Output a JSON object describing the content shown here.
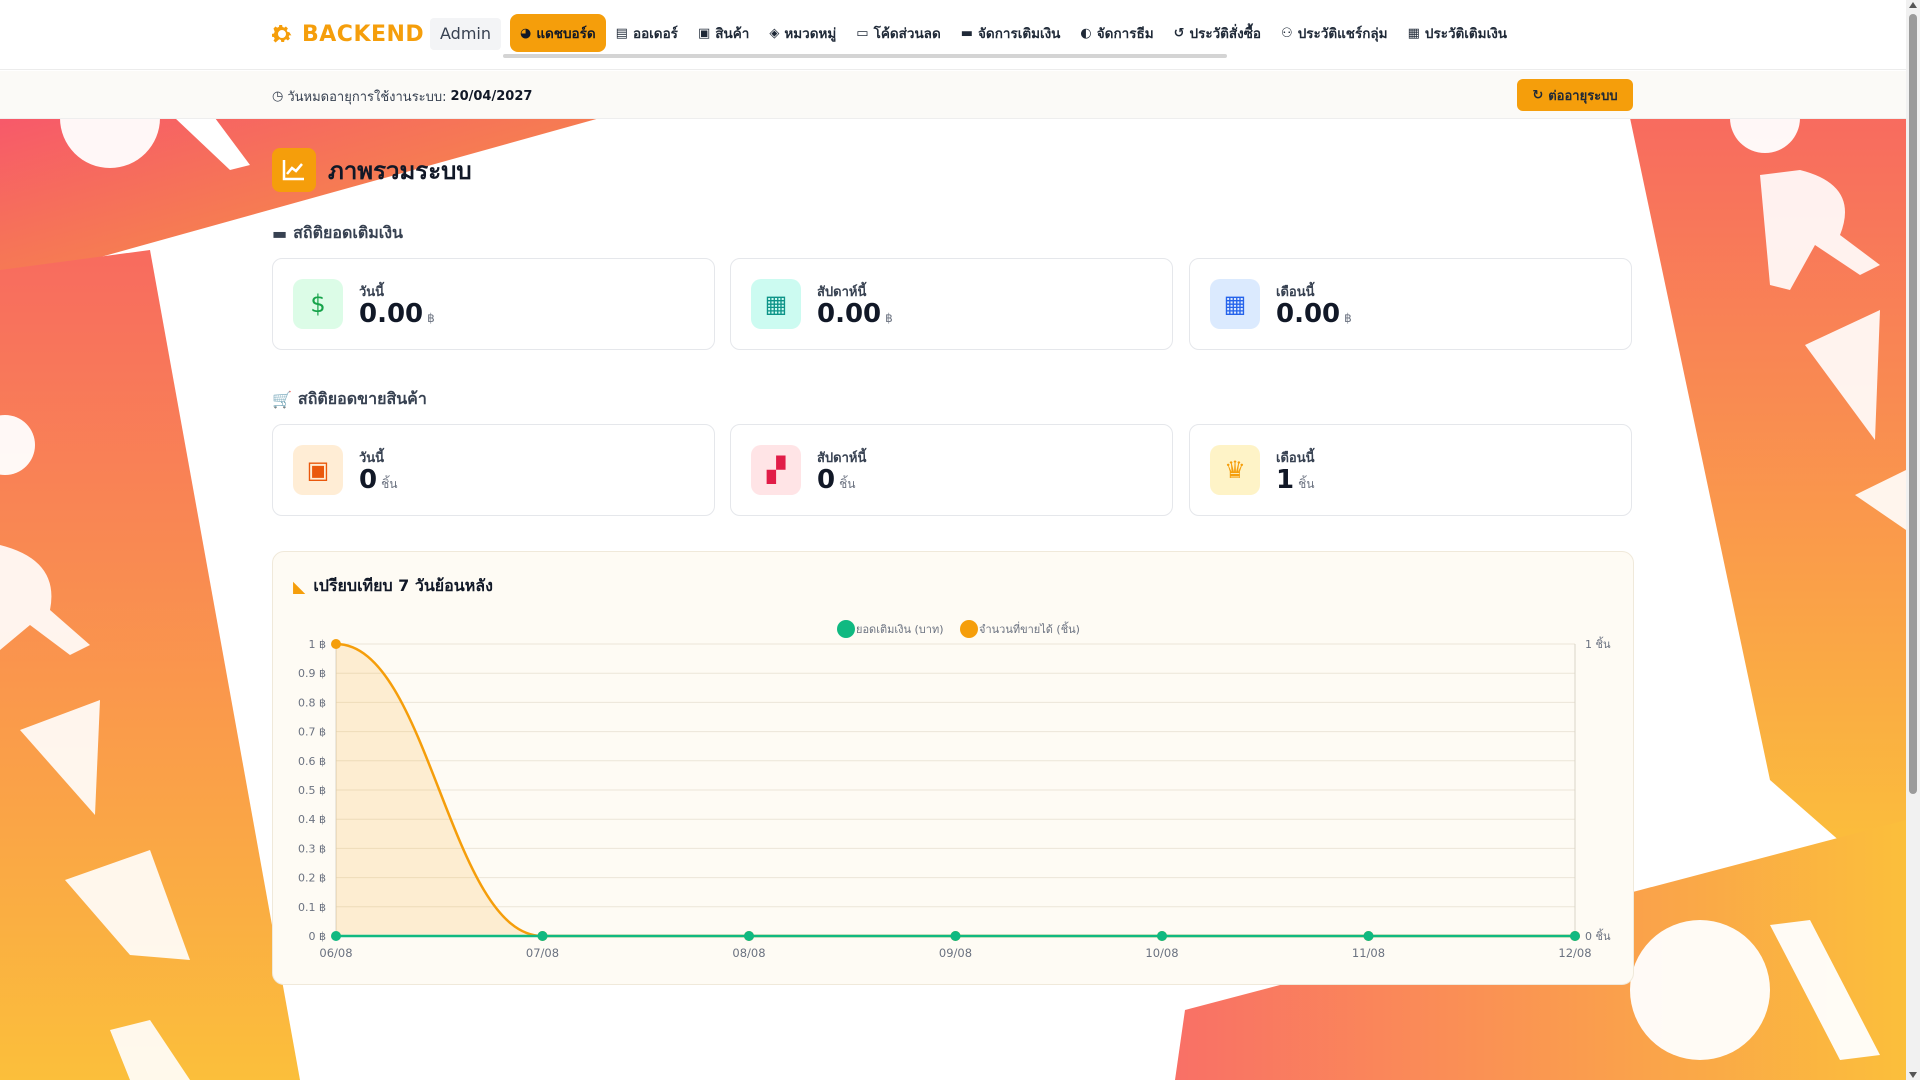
{
  "brand": {
    "name": "BACKEND",
    "role": "Admin",
    "icon": "gear-icon",
    "color": "#f59e0b"
  },
  "nav": {
    "items": [
      {
        "label": "แดชบอร์ด",
        "icon": "dashboard-icon",
        "active": true
      },
      {
        "label": "ออเดอร์",
        "icon": "clipboard-icon"
      },
      {
        "label": "สินค้า",
        "icon": "box-icon"
      },
      {
        "label": "หมวดหมู่",
        "icon": "tags-icon"
      },
      {
        "label": "โค้ดส่วนลด",
        "icon": "ticket-icon"
      },
      {
        "label": "จัดการเติมเงิน",
        "icon": "wallet-icon"
      },
      {
        "label": "จัดการธีม",
        "icon": "palette-icon"
      },
      {
        "label": "ประวัติสั่งซื้อ",
        "icon": "history-icon"
      },
      {
        "label": "ประวัติแชร์กลุ่ม",
        "icon": "users-icon"
      },
      {
        "label": "ประวัติเติมเงิน",
        "icon": "money-icon"
      }
    ]
  },
  "subbar": {
    "expiry_label": "วันหมดอายุการใช้งานระบบ:",
    "expiry_date": "20/04/2027",
    "renew_label": "ต่ออายุระบบ"
  },
  "page": {
    "title": "ภาพรวมระบบ",
    "topup_section": "สถิติยอดเติมเงิน",
    "sales_section": "สถิติยอดขายสินค้า",
    "topup_cards": [
      {
        "label": "วันนี้",
        "value": "0.00",
        "unit": "฿",
        "icon": "money-bag-icon",
        "bg": "#dcfce7",
        "fg": "#16a34a"
      },
      {
        "label": "สัปดาห์นี้",
        "value": "0.00",
        "unit": "฿",
        "icon": "calendar-week-icon",
        "bg": "#ccfbf1",
        "fg": "#0d9488"
      },
      {
        "label": "เดือนนี้",
        "value": "0.00",
        "unit": "฿",
        "icon": "calendar-icon",
        "bg": "#dbeafe",
        "fg": "#2563eb"
      }
    ],
    "sales_cards": [
      {
        "label": "วันนี้",
        "value": "0",
        "unit": "ชิ้น",
        "icon": "open-box-icon",
        "bg": "#ffedd5",
        "fg": "#ea580c"
      },
      {
        "label": "สัปดาห์นี้",
        "value": "0",
        "unit": "ชิ้น",
        "icon": "boxes-icon",
        "bg": "#ffe4e6",
        "fg": "#e11d48"
      },
      {
        "label": "เดือนนี้",
        "value": "1",
        "unit": "ชิ้น",
        "icon": "crown-icon",
        "bg": "#fef3c7",
        "fg": "#f59e0b"
      }
    ]
  },
  "chart_data": {
    "type": "line",
    "title": "เปรียบเทียบ 7 วันย้อนหลัง",
    "categories": [
      "06/08",
      "07/08",
      "08/08",
      "09/08",
      "10/08",
      "11/08",
      "12/08"
    ],
    "series": [
      {
        "name": "ยอดเติมเงิน (บาท)",
        "values": [
          0,
          0,
          0,
          0,
          0,
          0,
          0
        ],
        "color": "#10b981",
        "axis": "left"
      },
      {
        "name": "จำนวนที่ขายได้ (ชิ้น)",
        "values": [
          1,
          0,
          0,
          0,
          0,
          0,
          0
        ],
        "color": "#f59e0b",
        "axis": "right",
        "fill": true
      }
    ],
    "y_left": {
      "ylim": [
        0,
        1
      ],
      "ticks": [
        "0 ฿",
        "0.1 ฿",
        "0.2 ฿",
        "0.3 ฿",
        "0.4 ฿",
        "0.5 ฿",
        "0.6 ฿",
        "0.7 ฿",
        "0.8 ฿",
        "0.9 ฿",
        "1 ฿"
      ]
    },
    "y_right": {
      "ylim": [
        0,
        1
      ],
      "ticks": [
        "0 ชิ้น",
        "1 ชิ้น"
      ]
    },
    "legend": "top-center",
    "grid": true
  }
}
